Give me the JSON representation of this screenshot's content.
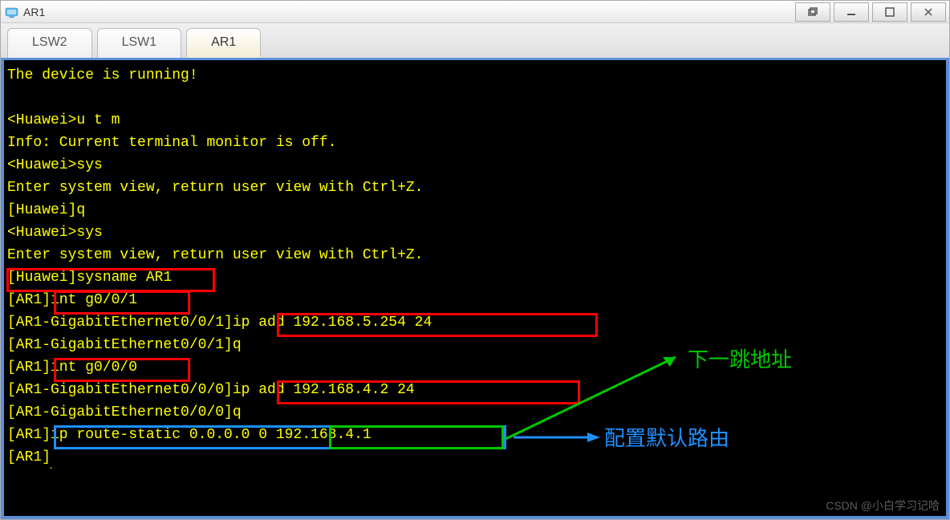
{
  "window": {
    "title": "AR1"
  },
  "tabs": [
    {
      "label": "LSW2",
      "active": false
    },
    {
      "label": "LSW1",
      "active": false
    },
    {
      "label": "AR1",
      "active": true
    }
  ],
  "terminal": {
    "lines": [
      "The device is running!",
      "",
      "<Huawei>u t m",
      "Info: Current terminal monitor is off.",
      "<Huawei>sys",
      "Enter system view, return user view with Ctrl+Z.",
      "[Huawei]q",
      "<Huawei>sys",
      "Enter system view, return user view with Ctrl+Z.",
      "[Huawei]sysname AR1",
      "[AR1]int g0/0/1",
      "[AR1-GigabitEthernet0/0/1]ip add 192.168.5.254 24",
      "[AR1-GigabitEthernet0/0/1]q",
      "[AR1]int g0/0/0",
      "[AR1-GigabitEthernet0/0/0]ip add 192.168.4.2 24",
      "[AR1-GigabitEthernet0/0/0]q",
      "[AR1]ip route-static 0.0.0.0 0 192.168.4.1",
      "[AR1]"
    ]
  },
  "annotations": {
    "next_hop": "下一跳地址",
    "default_route": "配置默认路由"
  },
  "watermark": "CSDN @小白学习记哈"
}
